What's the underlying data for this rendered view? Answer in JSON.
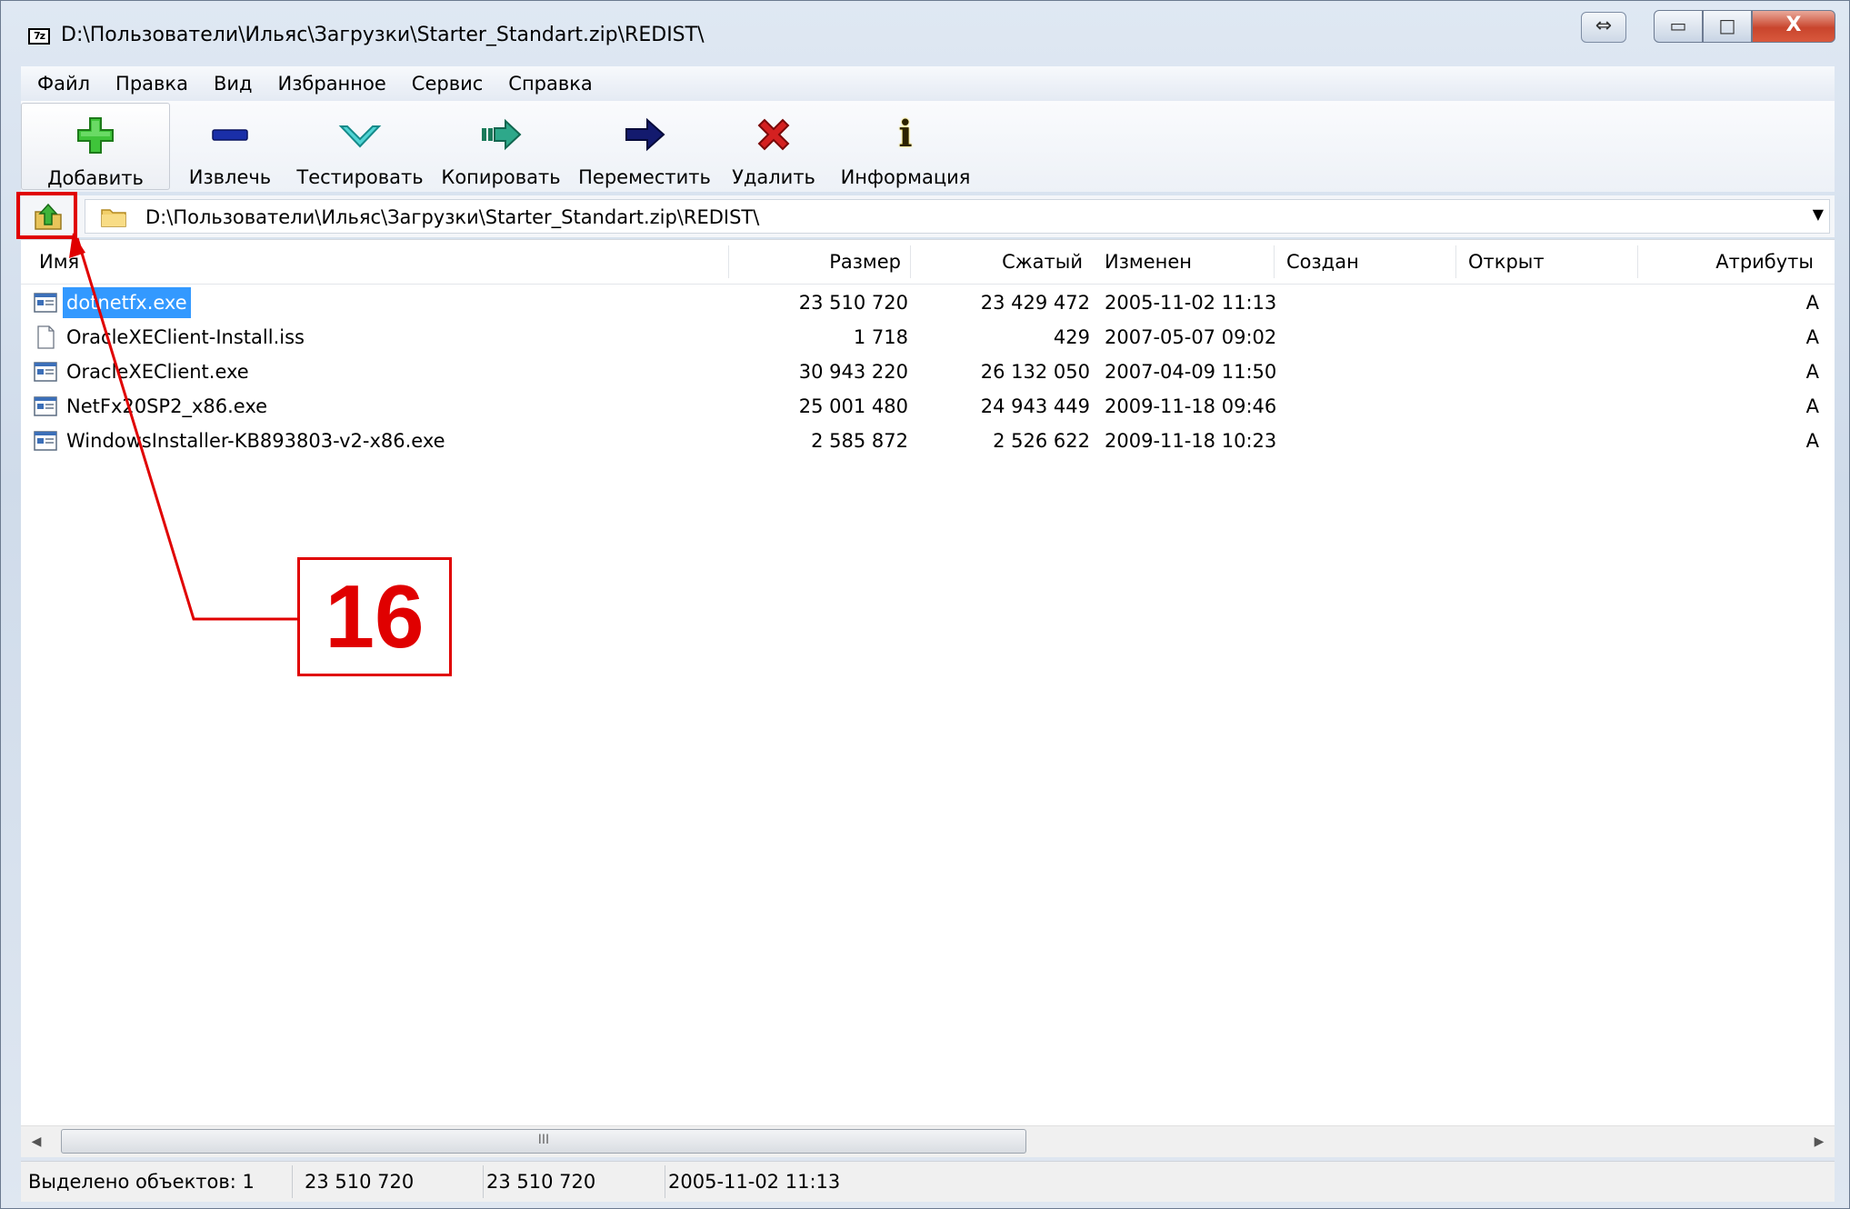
{
  "window": {
    "title": "D:\\Пользователи\\Ильяс\\Загрузки\\Starter_Standart.zip\\REDIST\\",
    "app_icon_text": "7z",
    "resize_glyph": "⇔",
    "min_glyph": "▭",
    "max_glyph": "□",
    "close_glyph": "X"
  },
  "menu": [
    "Файл",
    "Правка",
    "Вид",
    "Избранное",
    "Сервис",
    "Справка"
  ],
  "toolbar": {
    "add": "Добавить",
    "extract": "Извлечь",
    "test": "Тестировать",
    "copy": "Копировать",
    "move": "Переместить",
    "delete": "Удалить",
    "info": "Информация",
    "info_glyph": "i"
  },
  "address": {
    "path": "D:\\Пользователи\\Ильяс\\Загрузки\\Starter_Standart.zip\\REDIST\\",
    "dropdown_glyph": "▼"
  },
  "columns": {
    "name": "Имя",
    "size": "Размер",
    "packed": "Сжатый",
    "modified": "Изменен",
    "created": "Создан",
    "accessed": "Открыт",
    "attributes": "Атрибуты"
  },
  "files": [
    {
      "name": "dotnetfx.exe",
      "size": "23 510 720",
      "packed": "23 429 472",
      "modified": "2005-11-02 11:13",
      "attr": "A",
      "icon": "exe-icon",
      "selected": true
    },
    {
      "name": "OracleXEClient-Install.iss",
      "size": "1 718",
      "packed": "429",
      "modified": "2007-05-07 09:02",
      "attr": "A",
      "icon": "document-icon",
      "selected": false
    },
    {
      "name": "OracleXEClient.exe",
      "size": "30 943 220",
      "packed": "26 132 050",
      "modified": "2007-04-09 11:50",
      "attr": "A",
      "icon": "exe-icon",
      "selected": false
    },
    {
      "name": "NetFx20SP2_x86.exe",
      "size": "25 001 480",
      "packed": "24 943 449",
      "modified": "2009-11-18 09:46",
      "attr": "A",
      "icon": "exe-icon",
      "selected": false
    },
    {
      "name": "WindowsInstaller-KB893803-v2-x86.exe",
      "size": "2 585 872",
      "packed": "2 526 622",
      "modified": "2009-11-18 10:23",
      "attr": "A",
      "icon": "exe-icon",
      "selected": false
    }
  ],
  "scrollbar": {
    "left_glyph": "◀",
    "right_glyph": "▶",
    "grip_glyph": "III"
  },
  "status": {
    "selected": "Выделено объектов: 1",
    "size": "23 510 720",
    "packed": "23 510 720",
    "modified": "2005-11-02 11:13"
  },
  "annotation": {
    "number": "16",
    "color": "#e00000"
  }
}
